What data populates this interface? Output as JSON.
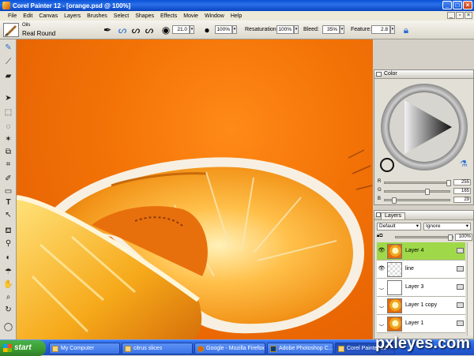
{
  "window": {
    "title": "Corel Painter 12 - [orange.psd @ 100%]",
    "min_icon": "minimize-icon",
    "max_icon": "maximize-icon",
    "close_icon": "close-icon"
  },
  "menu": {
    "items": [
      "File",
      "Edit",
      "Canvas",
      "Layers",
      "Brushes",
      "Select",
      "Shapes",
      "Effects",
      "Movie",
      "Window",
      "Help"
    ]
  },
  "propbar": {
    "brush_category": "Oils",
    "brush_variant": "Real Round",
    "size_value": "21.0",
    "opacity_value": "100%",
    "resaturation_label": "Resaturation:",
    "resaturation_value": "100%",
    "bleed_label": "Bleed:",
    "bleed_value": "35%",
    "feature_label": "Feature:",
    "feature_value": "2.8"
  },
  "toolbox": {
    "icons": [
      "brush-icon",
      "dropper-icon",
      "eraser-icon",
      "layer-adjuster-icon",
      "rect-select-icon",
      "lasso-icon",
      "magic-wand-icon",
      "transform-icon",
      "crop-icon",
      "pen-icon",
      "rectangle-shape-icon",
      "text-icon",
      "selection-arrow-icon",
      "paint-bucket-icon",
      "cloner-icon",
      "dodge-icon",
      "blend-icon",
      "hand-icon",
      "magnifier-icon",
      "rotate-icon",
      "color-swatch-icon"
    ]
  },
  "color_panel": {
    "title": "Color",
    "r_label": "R",
    "r_value": "255",
    "g_label": "G",
    "g_value": "165",
    "b_label": "B",
    "b_value": "29",
    "r_level": 1.0,
    "g_level": 0.65,
    "b_level": 0.11
  },
  "layers_panel": {
    "title": "Layers",
    "composite_method": "Default",
    "depth_option": "Ignore",
    "opacity_value": "100%",
    "layers": [
      {
        "name": "Layer 4",
        "thumb": "orange",
        "selected": true,
        "visible": true
      },
      {
        "name": "line",
        "thumb": "checker",
        "selected": false,
        "visible": true
      },
      {
        "name": "Layer 3",
        "thumb": "white",
        "selected": false,
        "visible": false
      },
      {
        "name": "Layer 1 copy",
        "thumb": "orange",
        "selected": false,
        "visible": false
      },
      {
        "name": "Layer 1",
        "thumb": "orange",
        "selected": false,
        "visible": false
      }
    ]
  },
  "taskbar": {
    "start_label": "start",
    "tasks": [
      {
        "label": "My Computer",
        "active": false
      },
      {
        "label": "citrus slices",
        "active": false
      },
      {
        "label": "Google - Mozilla Firefox",
        "active": false
      },
      {
        "label": "Adobe Photoshop C...",
        "active": false
      },
      {
        "label": "Corel Painter 12",
        "active": true
      }
    ]
  },
  "watermark": "pxleyes.com",
  "colors": {
    "canvas_orange": "#f37307",
    "selected_layer": "#9fd94a",
    "taskbar_blue": "#245edb"
  }
}
